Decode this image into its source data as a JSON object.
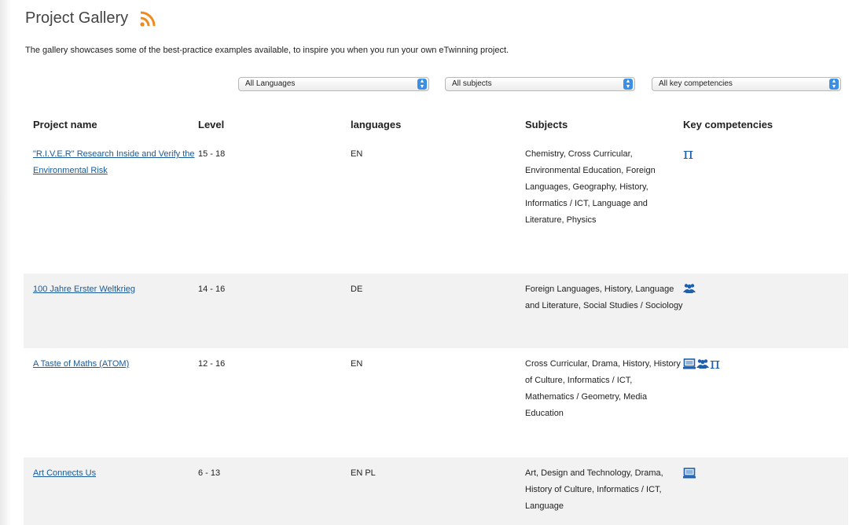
{
  "header": {
    "title": "Project Gallery",
    "rss_icon": "rss-feed-icon"
  },
  "intro": "The gallery showcases some of the best-practice examples available, to inspire you when you run your own eTwinning project.",
  "filters": {
    "languages": "All Languages",
    "subjects": "All subjects",
    "competencies": "All key competencies"
  },
  "table": {
    "headers": [
      "Project name",
      "Level",
      "languages",
      "Subjects",
      "Key competencies"
    ],
    "rows": [
      {
        "name": "\"R.I.V.E.R\" Research Inside and Verify the Environmental Risk",
        "level": "15 - 18",
        "languages": "EN",
        "subjects": "Chemistry, Cross Curricular, Environmental Education, Foreign Languages, Geography, History, Informatics / ICT, Language and Literature, Physics",
        "competencies": [
          "math-pi-icon"
        ]
      },
      {
        "name": "100 Jahre Erster Weltkrieg",
        "level": "14 - 16",
        "languages": "DE",
        "subjects": "Foreign Languages, History, Language and Literature, Social Studies / Sociology",
        "competencies": [
          "social-group-icon"
        ]
      },
      {
        "name": "A Taste of Maths (ATOM)",
        "level": "12 - 16",
        "languages": "EN",
        "subjects": "Cross Curricular, Drama, History, History of Culture, Informatics / ICT, Mathematics / Geometry, Media Education",
        "competencies": [
          "computer-icon",
          "social-group-icon",
          "math-pi-icon"
        ]
      },
      {
        "name": "Art Connects Us",
        "level": "6 - 13",
        "languages": "EN PL",
        "subjects": "Art, Design and Technology, Drama, History of Culture, Informatics / ICT, Language",
        "competencies": [
          "computer-icon"
        ]
      }
    ]
  },
  "colors": {
    "link": "#1a5a9a",
    "icon_blue": "#1f5fad",
    "rss_orange": "#f08a1c",
    "select_arrow": "#3b8fe5",
    "alt_row": "#f2f2f2"
  }
}
